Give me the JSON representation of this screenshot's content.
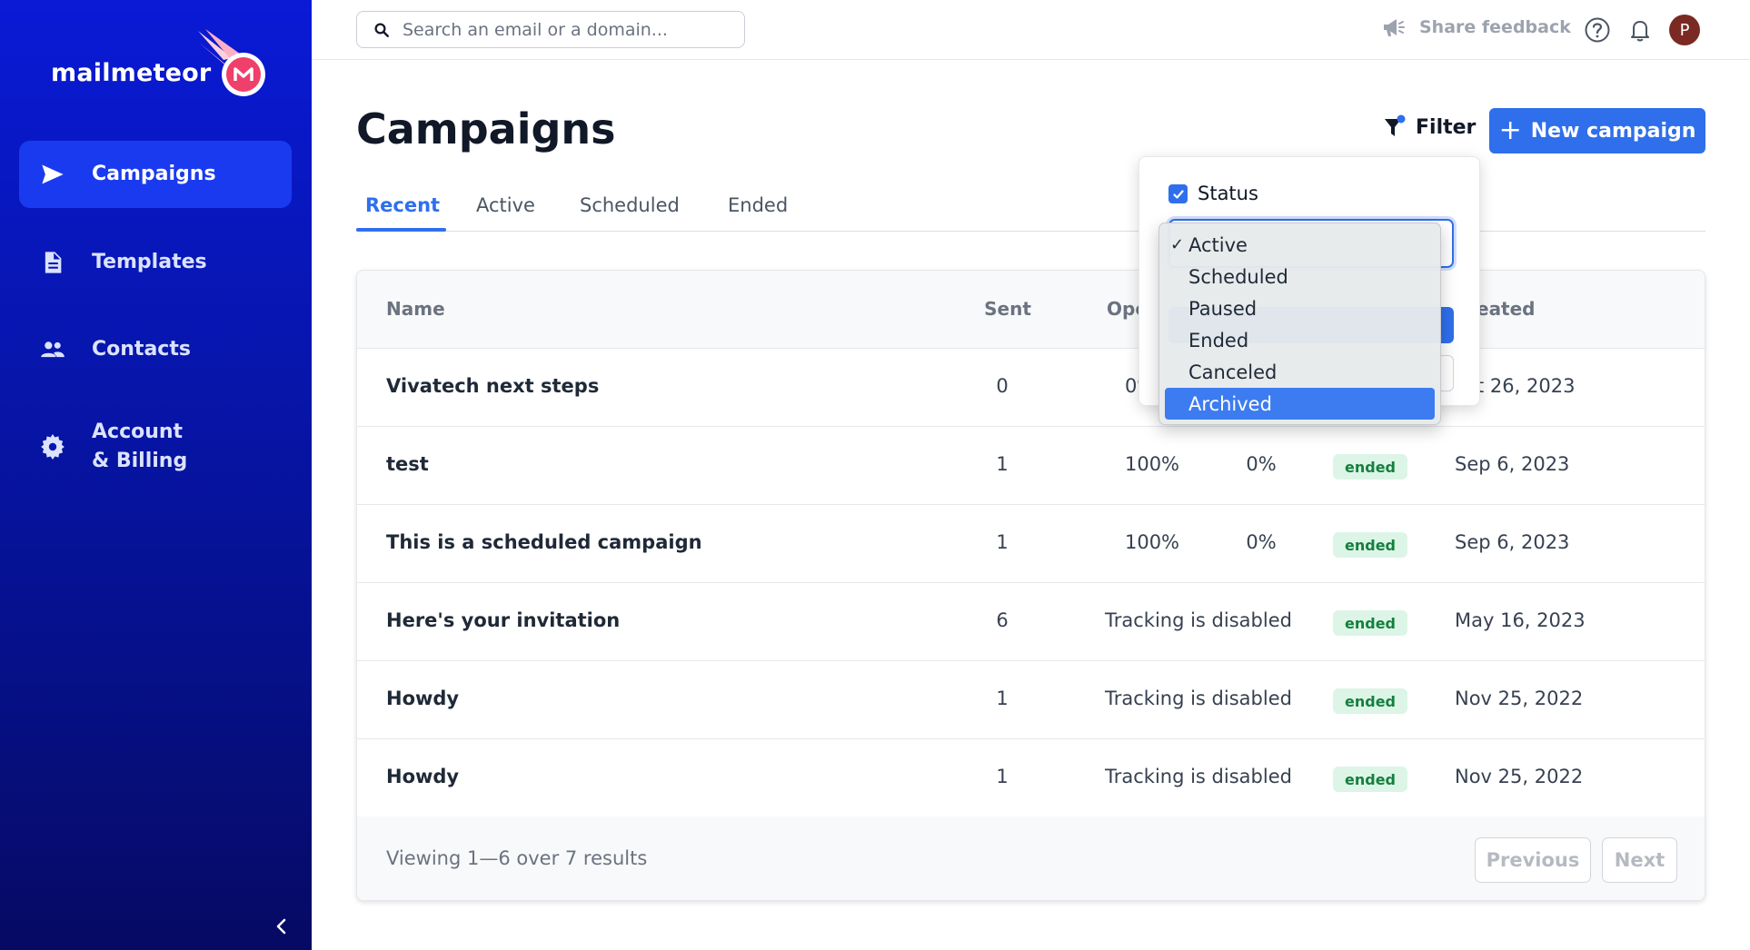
{
  "brand": {
    "name": "mailmeteor"
  },
  "sidebar": {
    "items": [
      {
        "label": "Campaigns",
        "icon": "send-icon",
        "active": true
      },
      {
        "label": "Templates",
        "icon": "document-icon",
        "active": false
      },
      {
        "label": "Contacts",
        "icon": "users-icon",
        "active": false
      },
      {
        "label": "Account\n& Billing",
        "label_line1": "Account",
        "label_line2": "& Billing",
        "icon": "gear-icon",
        "active": false
      }
    ],
    "collapse_icon": "chevron-left-icon"
  },
  "topbar": {
    "search_placeholder": "Search an email or a domain...",
    "search_value": "",
    "feedback_label": "Share feedback",
    "help_icon": "help-icon",
    "bell_icon": "bell-icon",
    "avatar_initial": "P"
  },
  "page": {
    "title": "Campaigns",
    "filter_label": "Filter",
    "new_campaign_label": "New campaign"
  },
  "tabs": [
    {
      "label": "Recent",
      "active": true
    },
    {
      "label": "Active",
      "active": false
    },
    {
      "label": "Scheduled",
      "active": false
    },
    {
      "label": "Ended",
      "active": false
    }
  ],
  "table": {
    "headers": {
      "name": "Name",
      "sent": "Sent",
      "opened": "Ope",
      "created": "eated"
    },
    "rows": [
      {
        "name": "Vivatech next steps",
        "sent": "0",
        "opened": "0%",
        "clicked": "",
        "tracking": "",
        "status": "",
        "created": "t 26, 2023"
      },
      {
        "name": "test",
        "sent": "1",
        "opened": "100%",
        "clicked": "0%",
        "tracking": "",
        "status": "ended",
        "created": "Sep 6, 2023"
      },
      {
        "name": "This is a scheduled campaign",
        "sent": "1",
        "opened": "100%",
        "clicked": "0%",
        "tracking": "",
        "status": "ended",
        "created": "Sep 6, 2023"
      },
      {
        "name": "Here's your invitation",
        "sent": "6",
        "opened": "",
        "clicked": "",
        "tracking": "Tracking is disabled",
        "status": "ended",
        "created": "May 16, 2023"
      },
      {
        "name": "Howdy",
        "sent": "1",
        "opened": "",
        "clicked": "",
        "tracking": "Tracking is disabled",
        "status": "ended",
        "created": "Nov 25, 2022"
      },
      {
        "name": "Howdy",
        "sent": "1",
        "opened": "",
        "clicked": "",
        "tracking": "Tracking is disabled",
        "status": "ended",
        "created": "Nov 25, 2022"
      }
    ],
    "footer": {
      "viewing": "Viewing 1—6 over 7 results",
      "previous": "Previous",
      "next": "Next"
    }
  },
  "filter_popover": {
    "status_label": "Status",
    "status_checked": true,
    "options": [
      {
        "label": "Active",
        "checked": true,
        "highlighted": false
      },
      {
        "label": "Scheduled",
        "checked": false,
        "highlighted": false
      },
      {
        "label": "Paused",
        "checked": false,
        "highlighted": false
      },
      {
        "label": "Ended",
        "checked": false,
        "highlighted": false
      },
      {
        "label": "Canceled",
        "checked": false,
        "highlighted": false
      },
      {
        "label": "Archived",
        "checked": false,
        "highlighted": true
      }
    ]
  },
  "colors": {
    "primary": "#2f6fec",
    "sidebar": "#0716b0",
    "badge_bg": "#dcf5e7",
    "badge_text": "#15803d"
  }
}
